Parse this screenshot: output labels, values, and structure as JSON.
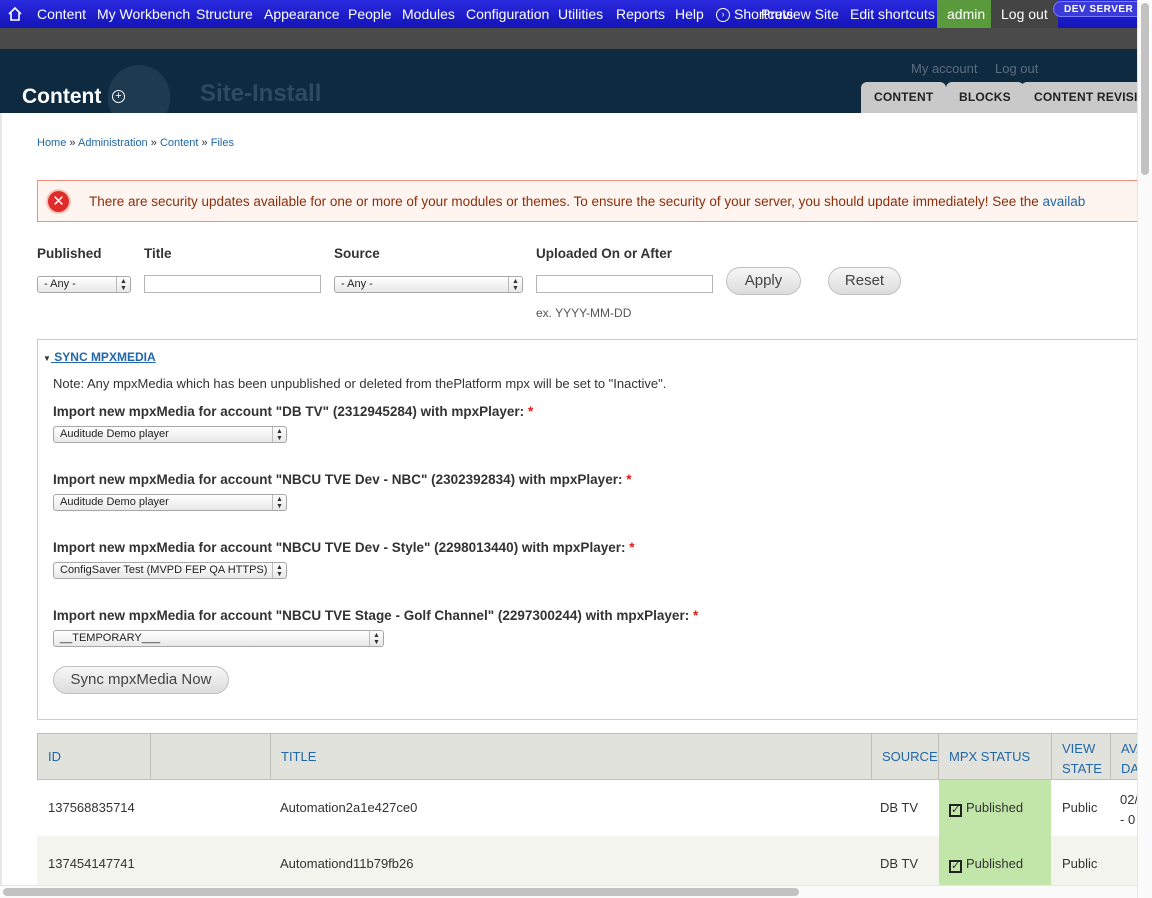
{
  "toolbar": {
    "home_icon": "home-icon",
    "items": [
      "Content",
      "My Workbench",
      "Structure",
      "Appearance",
      "People",
      "Modules",
      "Configuration",
      "Utilities",
      "Reports",
      "Help"
    ],
    "shortcuts_label": "Shortcuts",
    "preview_site": "Preview Site",
    "edit_shortcuts": "Edit shortcuts",
    "user": "admin",
    "logout": "Log out",
    "env_badge": "DEV SERVER",
    "colors": {
      "toolbar": "#1f1fcf",
      "admin_bg": "#5b9a3c",
      "logout_bg": "#444444"
    }
  },
  "header": {
    "page_title": "Content",
    "site_name": "Site-Install",
    "secondary": {
      "my_account": "My account",
      "log_out": "Log out"
    },
    "tabs": [
      "CONTENT",
      "BLOCKS",
      "CONTENT REVISIO"
    ]
  },
  "breadcrumb": [
    "Home",
    "Administration",
    "Content",
    "Files"
  ],
  "breadcrumb_sep": "»",
  "messages": {
    "security": {
      "text": "There are security updates available for one or more of your modules or themes. To ensure the security of your server, you should update immediately! See the ",
      "link": "availab"
    }
  },
  "filters": {
    "published": {
      "label": "Published",
      "value": "- Any -"
    },
    "title": {
      "label": "Title",
      "value": ""
    },
    "source": {
      "label": "Source",
      "value": "- Any -"
    },
    "uploaded": {
      "label": "Uploaded On or After",
      "value": "",
      "hint": "ex. YYYY-MM-DD"
    },
    "apply": "Apply",
    "reset": "Reset"
  },
  "sync": {
    "legend": "SYNC MPXMEDIA",
    "note": "Note: Any mpxMedia which has been unpublished or deleted from thePlatform mpx will be set to \"Inactive\".",
    "required_mark": "*",
    "accounts": [
      {
        "label": "Import new mpxMedia for account \"DB TV\" (2312945284) with mpxPlayer:",
        "player": "Auditude Demo player"
      },
      {
        "label": "Import new mpxMedia for account \"NBCU TVE Dev - NBC\" (2302392834) with mpxPlayer:",
        "player": "Auditude Demo player"
      },
      {
        "label": "Import new mpxMedia for account \"NBCU TVE Dev - Style\" (2298013440) with mpxPlayer:",
        "player": "ConfigSaver Test (MVPD FEP QA HTTPS)"
      },
      {
        "label": "Import new mpxMedia for account \"NBCU TVE Stage - Golf Channel\" (2297300244) with mpxPlayer:",
        "player": "__TEMPORARY___"
      }
    ],
    "button": "Sync mpxMedia Now"
  },
  "table": {
    "headers": {
      "id": "ID",
      "thumb": "",
      "title": "TITLE",
      "source": "SOURCE",
      "mpx_status": "MPX STATUS",
      "view_state_1": "VIEW",
      "view_state_2": "STATE",
      "avail_1": "AVA",
      "avail_2": "DAT"
    },
    "rows": [
      {
        "id": "137568835714",
        "title": "Automation2a1e427ce0",
        "source": "DB TV",
        "status": "Published",
        "view_state": "Public",
        "avail_1": "02/",
        "avail_2": "- 0"
      },
      {
        "id": "137454147741",
        "title": "Automationd11b79fb26",
        "source": "DB TV",
        "status": "Published",
        "view_state": "Public",
        "avail_1": "",
        "avail_2": ""
      }
    ],
    "colors": {
      "published_bg": "#c2e6a9",
      "alt_row_bg": "#f3f4ee",
      "header_bg": "#e1e2dc"
    }
  }
}
